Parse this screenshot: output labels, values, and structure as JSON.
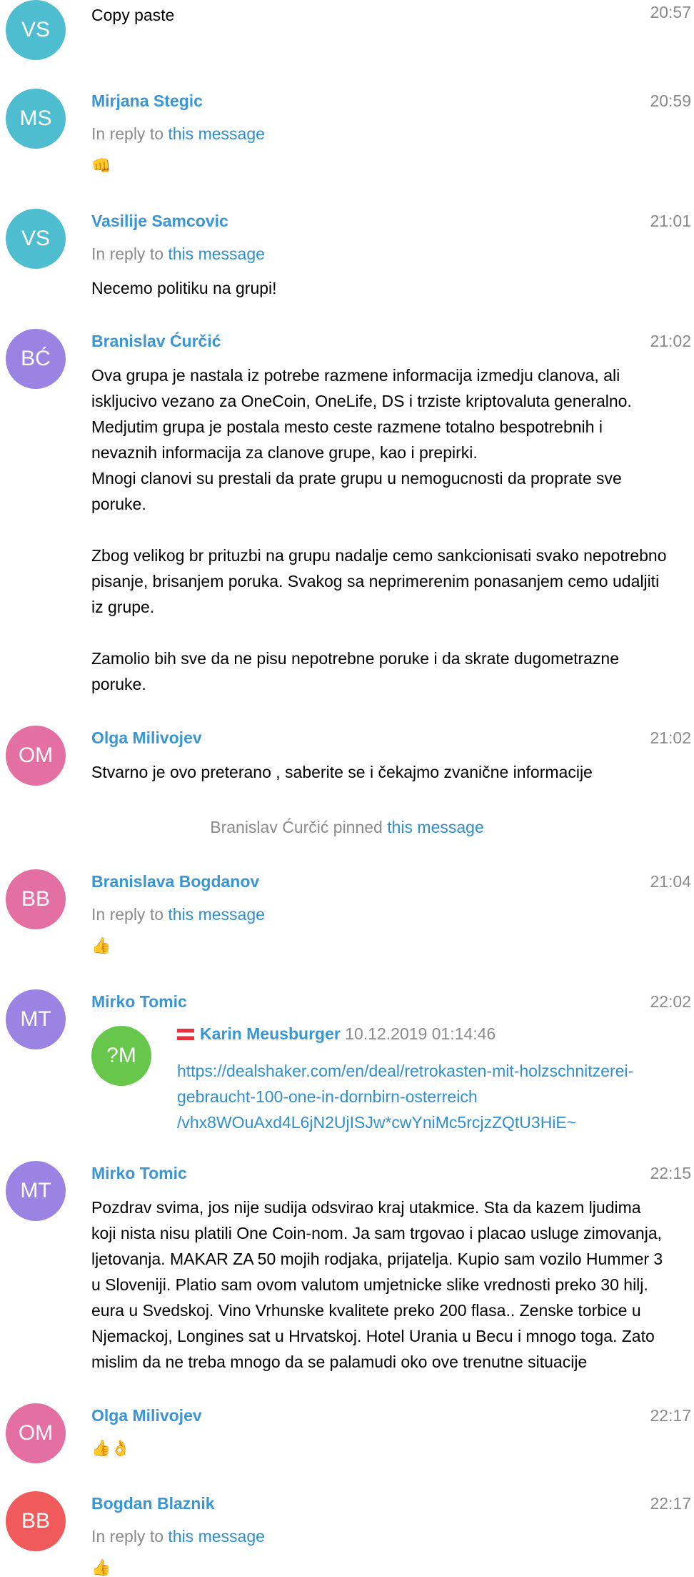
{
  "messages": {
    "m0": {
      "initials": "VS",
      "color": "#4fbdd0",
      "text": "Copy paste",
      "time": "20:57"
    },
    "m1": {
      "initials": "MS",
      "color": "#4fbdd0",
      "name": "Mirjana Stegic",
      "time": "20:59",
      "reply_prefix": "In reply to",
      "reply_link": "this message",
      "emoji": "👊"
    },
    "m2": {
      "initials": "VS",
      "color": "#4fbdd0",
      "name": "Vasilije Samcovic",
      "time": "21:01",
      "reply_prefix": "In reply to",
      "reply_link": "this message",
      "text": "Necemo politiku na grupi!"
    },
    "m3": {
      "initials": "BĆ",
      "color": "#9b83e3",
      "name": "Branislav Ćurčić",
      "time": "21:02",
      "text": "Ova grupa je nastala iz potrebe razmene informacija izmedju clanova, ali\niskljucivo vezano za OneCoin, OneLife, DS i trziste kriptovaluta generalno.\nMedjutim grupa je postala mesto ceste razmene totalno bespotrebnih i\nnevaznih informacija za clanove grupe, kao i prepirki.\nMnogi clanovi su prestali da prate grupu u nemogucnosti da proprate sve\nporuke.\n\nZbog velikog br prituzbi na grupu nadalje cemo sankcionisati svako nepotrebno\npisanje, brisanjem poruka. Svakog sa neprimerenim ponasanjem cemo udaljiti\niz grupe.\n\nZamolio bih sve da ne pisu nepotrebne poruke i da skrate dugometrazne\nporuke."
    },
    "m4": {
      "initials": "OM",
      "color": "#e46fa2",
      "name": "Olga Milivojev",
      "time": "21:02",
      "text": "Stvarno je ovo preterano , saberite se i čekajmo zvanične informacije"
    },
    "service": {
      "actor": "Branislav Ćurčić",
      "action": "pinned",
      "link": "this message"
    },
    "m5": {
      "initials": "BB",
      "color": "#e46fa2",
      "name": "Branislava Bogdanov",
      "time": "21:04",
      "reply_prefix": "In reply to",
      "reply_link": "this message",
      "emoji": "👍"
    },
    "m6": {
      "initials": "MT",
      "color": "#9b83e3",
      "name": "Mirko Tomic",
      "time": "22:02",
      "forward": {
        "initials": "?M",
        "name": "Karin Meusburger",
        "date": "10.12.2019 01:14:46",
        "link": "https://dealshaker.com/en/deal/retrokasten-mit-holzschnitzerei-\ngebraucht-100-one-in-dornbirn-osterreich\n/vhx8WOuAxd4L6jN2UjISJw*cwYniMc5rcjzZQtU3HiE~"
      }
    },
    "m7": {
      "initials": "MT",
      "color": "#9b83e3",
      "name": "Mirko Tomic",
      "time": "22:15",
      "text": "Pozdrav svima, jos nije sudija odsvirao kraj utakmice. Sta da kazem ljudima\nkoji nista nisu platili One Coin-nom. Ja sam trgovao i placao usluge zimovanja,\nljetovanja. MAKAR ZA 50 mojih rodjaka, prijatelja. Kupio sam vozilo Hummer 3\nu Sloveniji. Platio sam ovom valutom umjetnicke slike vrednosti preko 30 hilj.\neura u Svedskoj. Vino Vrhunske kvalitete preko 200 flasa.. Zenske torbice u\nNjemackoj, Longines sat u Hrvatskoj. Hotel Urania u Becu i mnogo toga. Zato\nmislim da ne treba mnogo da se palamudi oko ove trenutne situacije"
    },
    "m8": {
      "initials": "OM",
      "color": "#e46fa2",
      "name": "Olga Milivojev",
      "time": "22:17",
      "emoji": "👍👌"
    },
    "m9": {
      "initials": "BB",
      "color": "#f05a5a",
      "name": "Bogdan Blaznik",
      "time": "22:17",
      "reply_prefix": "In reply to",
      "reply_link": "this message",
      "emoji": "👍"
    }
  }
}
